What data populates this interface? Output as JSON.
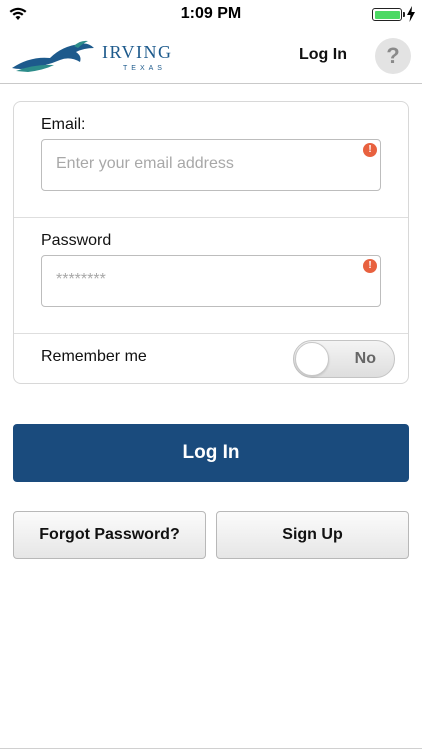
{
  "status_bar": {
    "time": "1:09 PM"
  },
  "nav": {
    "logo_word": "IRVING",
    "logo_sub": "TEXAS",
    "title": "Log In",
    "help_label": "?"
  },
  "form": {
    "email": {
      "label": "Email:",
      "placeholder": "Enter your email address",
      "error_icon": "!"
    },
    "password": {
      "label": "Password",
      "placeholder": "********",
      "error_icon": "!"
    },
    "remember": {
      "label": "Remember me",
      "toggle_value": "No"
    }
  },
  "actions": {
    "login_label": "Log In",
    "forgot_label": "Forgot Password?",
    "signup_label": "Sign Up"
  },
  "colors": {
    "primary": "#1a4b7d",
    "error": "#e8613f",
    "battery": "#4cd964"
  }
}
